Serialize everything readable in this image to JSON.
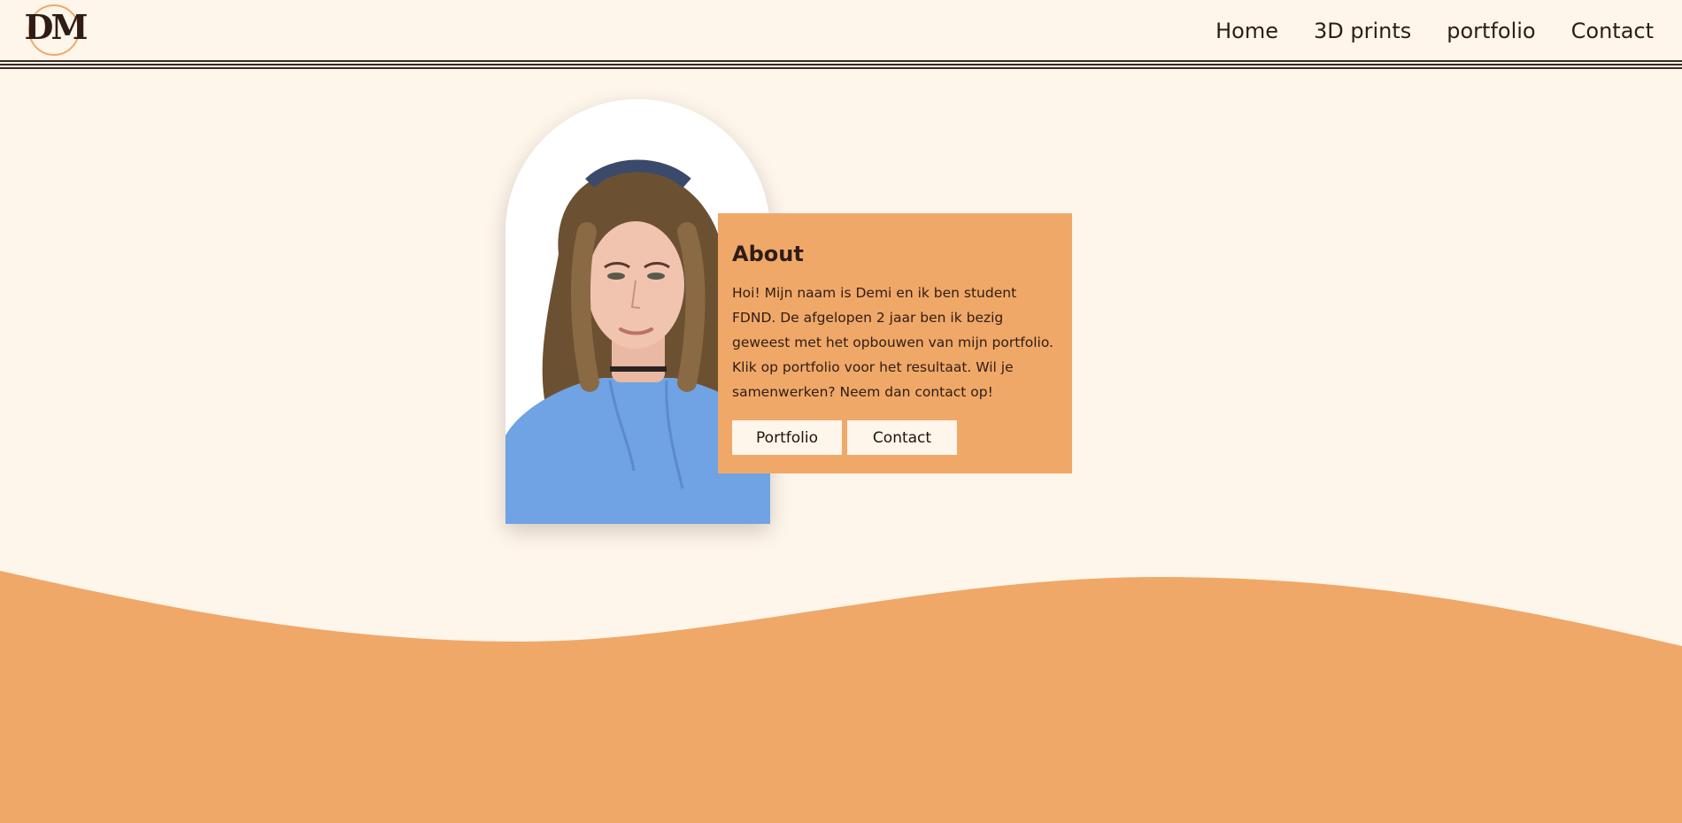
{
  "header": {
    "logo_text": "DM",
    "nav": [
      {
        "label": "Home"
      },
      {
        "label": "3D prints"
      },
      {
        "label": "portfolio"
      },
      {
        "label": "Contact"
      }
    ]
  },
  "about": {
    "title": "About",
    "text": "Hoi! Mijn naam is Demi en ik ben student FDND. De afgelopen 2 jaar ben ik bezig geweest met het opbouwen van mijn portfolio. Klik op portfolio voor het resultaat. Wil je samenwerken? Neem dan contact op!",
    "portfolio_button": "Portfolio",
    "contact_button": "Contact"
  },
  "colors": {
    "background": "#fef5eb",
    "accent": "#f0a868",
    "text": "#2e1d16"
  }
}
